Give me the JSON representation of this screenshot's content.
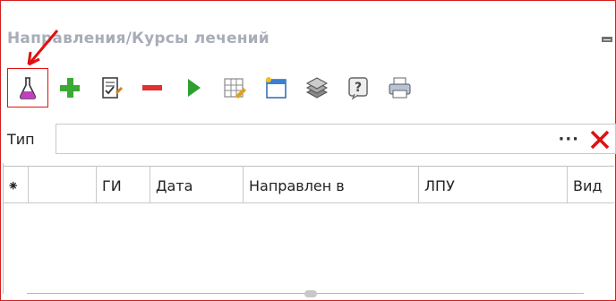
{
  "panel": {
    "title": "Направления/Курсы лечений"
  },
  "toolbar": {
    "buttons": [
      {
        "name": "lab-flask",
        "icon": "flask-icon"
      },
      {
        "name": "add",
        "icon": "plus-icon"
      },
      {
        "name": "edit",
        "icon": "edit-document-icon"
      },
      {
        "name": "delete",
        "icon": "minus-icon"
      },
      {
        "name": "run",
        "icon": "play-icon"
      },
      {
        "name": "edit-grid",
        "icon": "grid-edit-icon"
      },
      {
        "name": "new-window",
        "icon": "new-window-icon"
      },
      {
        "name": "stack",
        "icon": "stack-icon"
      },
      {
        "name": "help",
        "icon": "help-icon"
      },
      {
        "name": "print",
        "icon": "print-icon"
      }
    ]
  },
  "filter": {
    "label": "Тип",
    "value": "",
    "dots": "···"
  },
  "grid": {
    "columns": [
      "⁕",
      "",
      "ГИ",
      "Дата",
      "Направлен в",
      "ЛПУ",
      "Вид"
    ],
    "rows": []
  },
  "colors": {
    "frame_border": "#d02020",
    "title_color": "#a8adb8",
    "add_green": "#3aaa35",
    "delete_red": "#e03030",
    "play_green": "#2fa02f",
    "flask_pink": "#c040c0"
  }
}
